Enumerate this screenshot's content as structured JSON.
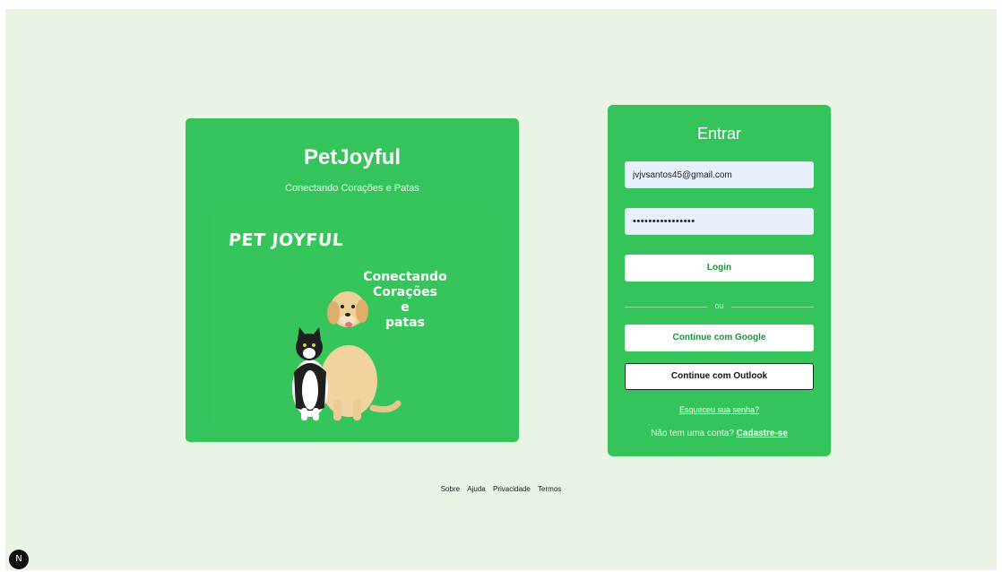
{
  "promo": {
    "title": "PetJoyful",
    "subtitle": "Conectando Corações e Patas",
    "image": {
      "brand": "PET JOYFUL",
      "caption_lines": [
        "Conectando",
        "Corações",
        "e",
        "patas"
      ]
    }
  },
  "login": {
    "title": "Entrar",
    "email_value": "jvjvsantos45@gmail.com",
    "password_value": "••••••••••••••••",
    "login_button": "Login",
    "divider": "ou",
    "google_button": "Continue com Google",
    "outlook_button": "Continue com Outlook",
    "forgot_link": "Esqueceu sua senha?",
    "signup_prompt": "Não tem uma conta?",
    "signup_link": "Cadastre-se"
  },
  "footer": {
    "links": [
      "Sobre",
      "Ajuda",
      "Privacidade",
      "Termos"
    ]
  },
  "dev_badge": "N",
  "colors": {
    "background": "#eaf4e4",
    "card_green": "#35c45c",
    "input_bg": "#e8f0fe"
  }
}
